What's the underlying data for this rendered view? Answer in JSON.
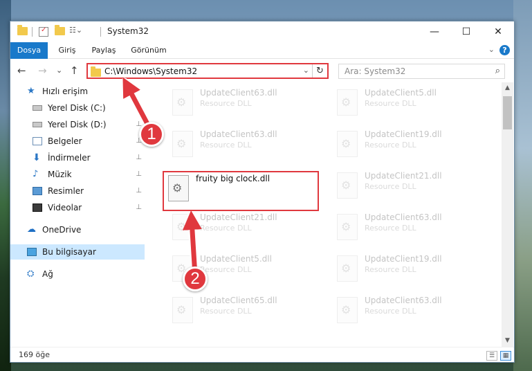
{
  "window": {
    "title": "System32",
    "controls": {
      "minimize": "—",
      "maximize": "☐",
      "close": "✕"
    }
  },
  "ribbon": {
    "tabs": [
      "Dosya",
      "Giriş",
      "Paylaş",
      "Görünüm"
    ],
    "help": "?",
    "collapse": "⌄"
  },
  "nav": {
    "back": "←",
    "forward": "→",
    "recent": "⌄",
    "up": "↑",
    "address": "C:\\Windows\\System32",
    "dropdown": "⌄",
    "refresh": "↻",
    "search_placeholder": "Ara: System32",
    "search_icon": "⌕"
  },
  "sidebar": {
    "items": [
      {
        "label": "Hızlı erişim",
        "icon": "star-icon",
        "glyph": "★",
        "pinned": false
      },
      {
        "label": "Yerel Disk (C:)",
        "icon": "disk-icon",
        "glyph": "",
        "pinned": true
      },
      {
        "label": "Yerel Disk (D:)",
        "icon": "disk-icon",
        "glyph": "",
        "pinned": true
      },
      {
        "label": "Belgeler",
        "icon": "documents-icon",
        "glyph": "",
        "pinned": true
      },
      {
        "label": "İndirmeler",
        "icon": "download-icon",
        "glyph": "⬇",
        "pinned": true
      },
      {
        "label": "Müzik",
        "icon": "music-icon",
        "glyph": "♪",
        "pinned": true
      },
      {
        "label": "Resimler",
        "icon": "pictures-icon",
        "glyph": "",
        "pinned": true
      },
      {
        "label": "Videolar",
        "icon": "videos-icon",
        "glyph": "",
        "pinned": true
      },
      {
        "label": "OneDrive",
        "icon": "cloud-icon",
        "glyph": "☁",
        "pinned": false
      },
      {
        "label": "Bu bilgisayar",
        "icon": "computer-icon",
        "glyph": "",
        "pinned": false,
        "selected": true
      },
      {
        "label": "Ağ",
        "icon": "network-icon",
        "glyph": "⛭",
        "pinned": false
      }
    ],
    "pin_glyph": "📌"
  },
  "files": [
    {
      "name": "UpdateClient63.dll",
      "type": "Resource DLL",
      "faded": true
    },
    {
      "name": "UpdateClient5.dll",
      "type": "Resource DLL",
      "faded": true
    },
    {
      "name": "UpdateClient63.dll",
      "type": "Resource DLL",
      "faded": true
    },
    {
      "name": "UpdateClient19.dll",
      "type": "Resource DLL",
      "faded": true
    },
    {
      "name": "fruity big clock.dll",
      "type": "",
      "faded": false,
      "highlight": true
    },
    {
      "name": "UpdateClient21.dll",
      "type": "Resource DLL",
      "faded": true
    },
    {
      "name": "UpdateClient21.dll",
      "type": "Resource DLL",
      "faded": true
    },
    {
      "name": "UpdateClient63.dll",
      "type": "Resource DLL",
      "faded": true
    },
    {
      "name": "UpdateClient5.dll",
      "type": "Resource DLL",
      "faded": true
    },
    {
      "name": "UpdateClient19.dll",
      "type": "Resource DLL",
      "faded": true
    },
    {
      "name": "UpdateClient65.dll",
      "type": "Resource DLL",
      "faded": true
    },
    {
      "name": "UpdateClient63.dll",
      "type": "Resource DLL",
      "faded": true
    }
  ],
  "scrollbar": {
    "up": "▲",
    "down": "▼"
  },
  "status": {
    "count": "169 öğe",
    "details_view": "☰",
    "tiles_view": "▦"
  },
  "annotations": {
    "step1": "1",
    "step2": "2",
    "color": "#e0383e"
  }
}
